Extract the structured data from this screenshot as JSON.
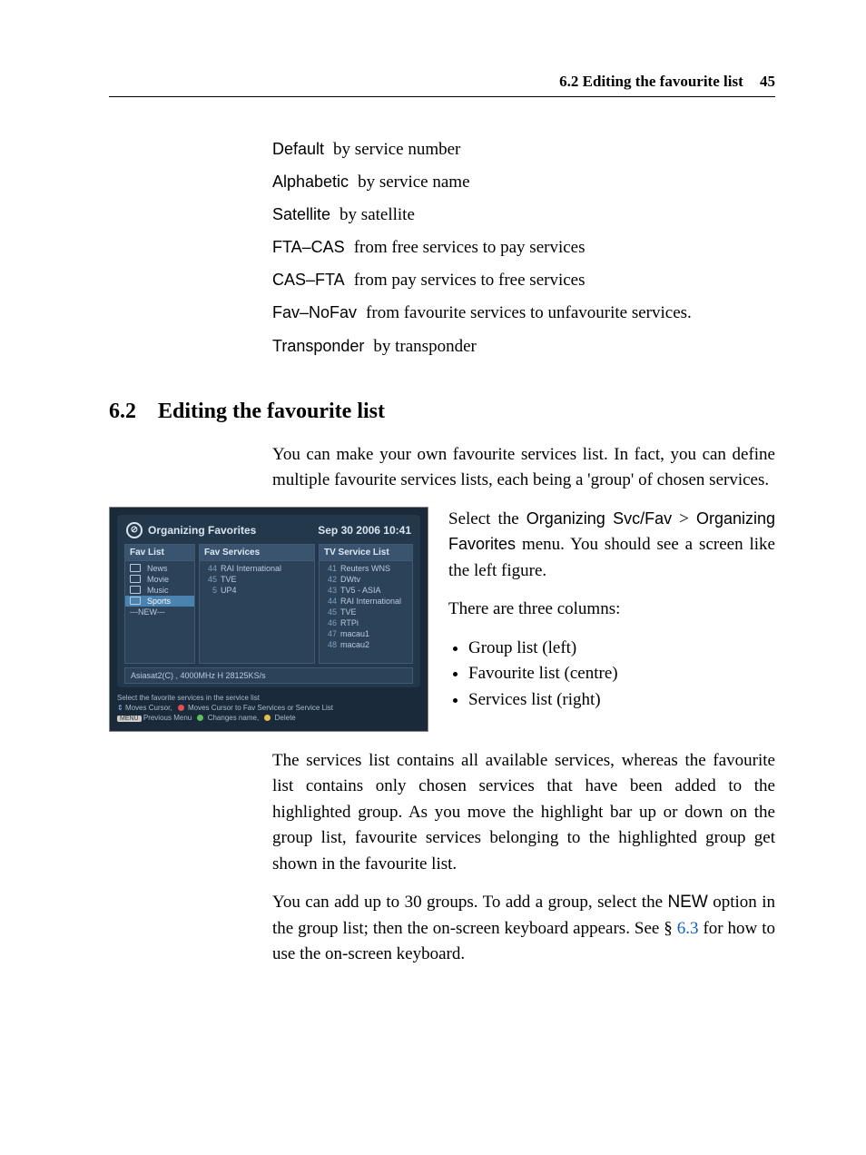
{
  "header": {
    "title": "6.2 Editing the favourite list",
    "page": "45"
  },
  "sort_options": [
    {
      "term": "Default",
      "desc": "by service number"
    },
    {
      "term": "Alphabetic",
      "desc": "by service name"
    },
    {
      "term": "Satellite",
      "desc": "by satellite"
    },
    {
      "term": "FTA–CAS",
      "desc": "from free services to pay services"
    },
    {
      "term": "CAS–FTA",
      "desc": "from pay services to free services"
    },
    {
      "term": "Fav–NoFav",
      "desc": "from favourite services to unfavourite services."
    },
    {
      "term": "Transponder",
      "desc": "by transponder"
    }
  ],
  "section": {
    "number": "6.2",
    "title": "Editing the favourite list"
  },
  "intro": "You can make your own favourite services list. In fact, you can define multiple favourite services lists, each being a 'group' of chosen services.",
  "side": {
    "p1a": "Select the ",
    "p1b": "Organizing Svc/Fav",
    "p1c": " > ",
    "p1d": "Organizing Favorites",
    "p1e": " menu. You should see a screen like the left figure.",
    "p2": "There are three columns:",
    "bullets": [
      "Group list (left)",
      "Favourite list (centre)",
      "Services list (right)"
    ]
  },
  "para2": "The services list contains all available services, whereas the favourite list contains only chosen services that have been added to the highlighted group. As you move the highlight bar up or down on the group list, favourite services belonging to the highlighted group get shown in the favourite list.",
  "para3a": "You can add up to 30 groups. To add a group, select the ",
  "para3b": "NEW",
  "para3c": " option in the group list; then the on-screen keyboard appears. See § ",
  "para3d": "6.3",
  "para3e": " for how to use the on-screen keyboard.",
  "screenshot": {
    "title": "Organizing Favorites",
    "timestamp": "Sep 30 2006 10:41",
    "col_headers": [
      "Fav List",
      "Fav Services",
      "TV Service List"
    ],
    "fav_list": [
      "News",
      "Movie",
      "Music",
      "Sports",
      "---NEW---"
    ],
    "fav_list_selected": 3,
    "fav_services": [
      {
        "n": "44",
        "t": "RAI International"
      },
      {
        "n": "45",
        "t": "TVE"
      },
      {
        "n": "5",
        "t": "UP4"
      }
    ],
    "tv_list": [
      {
        "n": "41",
        "t": "Reuters WNS"
      },
      {
        "n": "42",
        "t": "DWtv"
      },
      {
        "n": "43",
        "t": "TV5 - ASIA"
      },
      {
        "n": "44",
        "t": "RAI International"
      },
      {
        "n": "45",
        "t": "TVE"
      },
      {
        "n": "46",
        "t": "RTPi"
      },
      {
        "n": "47",
        "t": "macau1"
      },
      {
        "n": "48",
        "t": "macau2"
      }
    ],
    "status": "Asiasat2(C) , 4000MHz H 28125KS/s",
    "hint1": "Select the favorite services in the service list",
    "hint2a": "Moves Cursor, ",
    "hint2b": "Moves Cursor to Fav Services or Service List",
    "hint3a": "Previous Menu ",
    "hint3b": "Changes name, ",
    "hint3c": "Delete"
  }
}
